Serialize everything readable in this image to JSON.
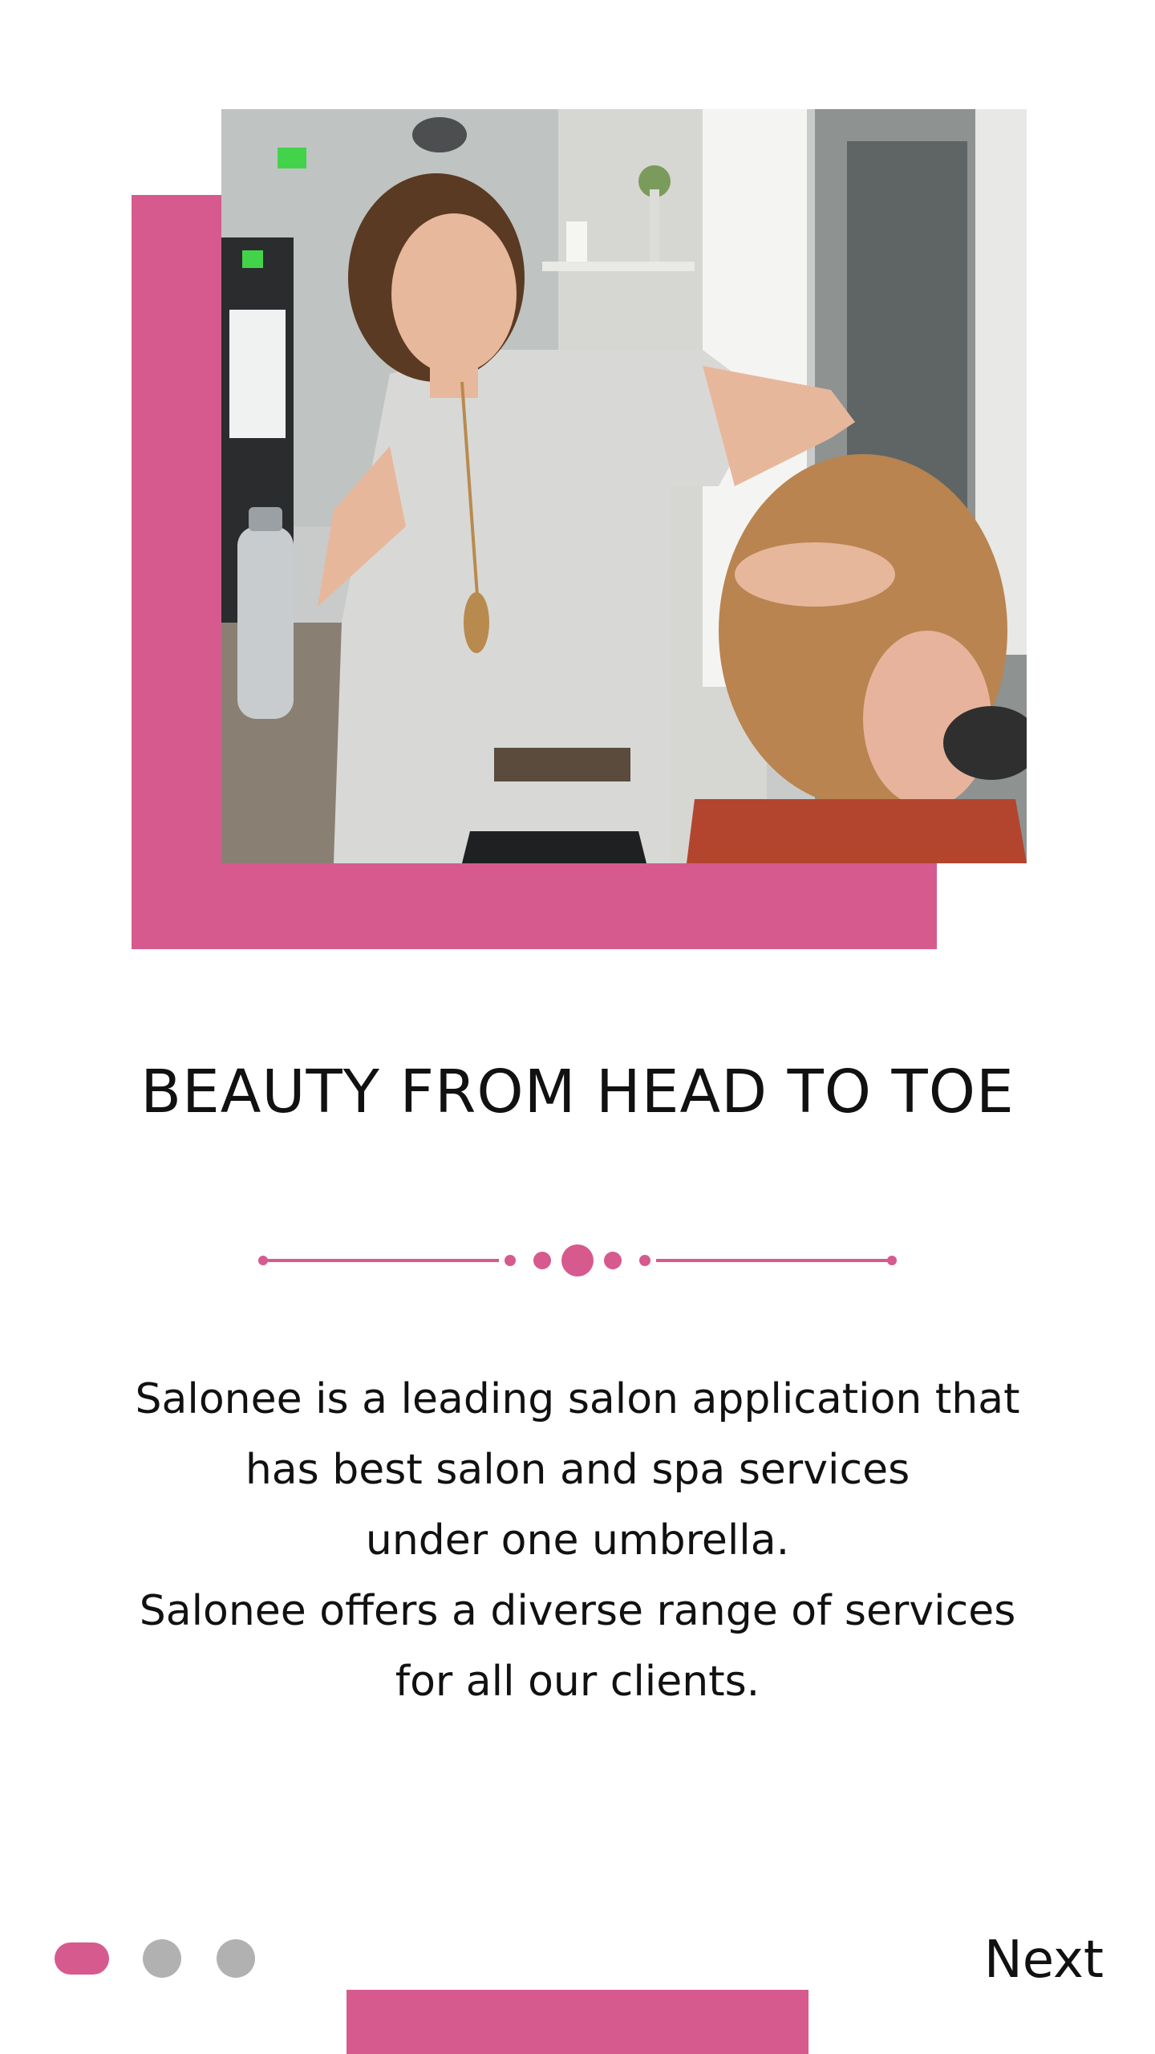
{
  "colors": {
    "accent": "#d65a8e",
    "inactive_dot": "#b1b1b1",
    "text": "#111111",
    "background": "#ffffff"
  },
  "hero": {
    "image": "salon-stylist-photo"
  },
  "headline": "BEAUTY FROM HEAD TO TOE",
  "divider": {
    "icon": "dotted-line-divider"
  },
  "description": {
    "lines": [
      "Salonee is a leading salon application that",
      "has best salon and spa services",
      "under one umbrella.",
      "Salonee offers a diverse range of services",
      "for all our clients."
    ]
  },
  "pager": {
    "total": 3,
    "active_index": 0
  },
  "footer": {
    "next_label": "Next"
  }
}
